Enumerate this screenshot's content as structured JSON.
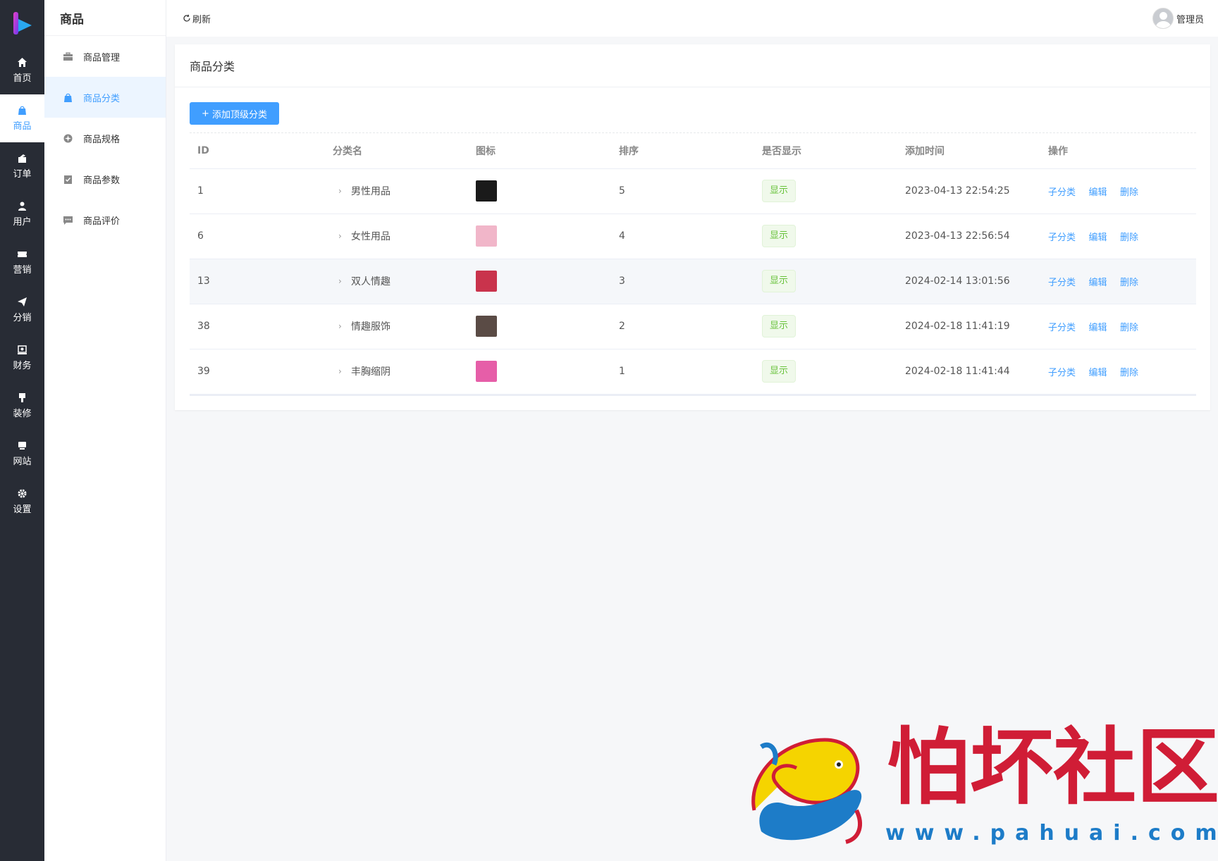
{
  "rail": {
    "items": [
      {
        "label": "首页",
        "icon": "home-icon"
      },
      {
        "label": "商品",
        "icon": "bag-icon",
        "active": true
      },
      {
        "label": "订单",
        "icon": "order-icon"
      },
      {
        "label": "用户",
        "icon": "user-icon"
      },
      {
        "label": "营销",
        "icon": "ticket-icon"
      },
      {
        "label": "分销",
        "icon": "send-icon"
      },
      {
        "label": "财务",
        "icon": "finance-icon"
      },
      {
        "label": "装修",
        "icon": "brush-icon"
      },
      {
        "label": "网站",
        "icon": "monitor-icon"
      },
      {
        "label": "设置",
        "icon": "gear-icon"
      }
    ]
  },
  "subnav": {
    "title": "商品",
    "items": [
      {
        "label": "商品管理",
        "icon": "briefcase-icon"
      },
      {
        "label": "商品分类",
        "icon": "bag-icon",
        "active": true
      },
      {
        "label": "商品规格",
        "icon": "spec-icon"
      },
      {
        "label": "商品参数",
        "icon": "clipboard-icon"
      },
      {
        "label": "商品评价",
        "icon": "comment-icon"
      }
    ]
  },
  "topbar": {
    "refresh_label": "刷新",
    "user_name": "管理员"
  },
  "card": {
    "title": "商品分类",
    "add_button": "添加顶级分类"
  },
  "table": {
    "headers": [
      "ID",
      "分类名",
      "图标",
      "排序",
      "是否显示",
      "添加时间",
      "操作"
    ],
    "rows": [
      {
        "id": "1",
        "name": "男性用品",
        "sort": "5",
        "show": "显示",
        "time": "2023-04-13 22:54:25",
        "thumb_color": "#1a1a1a"
      },
      {
        "id": "6",
        "name": "女性用品",
        "sort": "4",
        "show": "显示",
        "time": "2023-04-13 22:56:54",
        "thumb_color": "#f1b6c9"
      },
      {
        "id": "13",
        "name": "双人情趣",
        "sort": "3",
        "show": "显示",
        "time": "2024-02-14 13:01:56",
        "thumb_color": "#c9334c"
      },
      {
        "id": "38",
        "name": "情趣服饰",
        "sort": "2",
        "show": "显示",
        "time": "2024-02-18 11:41:19",
        "thumb_color": "#5a4b45"
      },
      {
        "id": "39",
        "name": "丰胸缩阴",
        "sort": "1",
        "show": "显示",
        "time": "2024-02-18 11:41:44",
        "thumb_color": "#e65ea8"
      }
    ],
    "ops": {
      "sub": "子分类",
      "edit": "编辑",
      "del": "删除"
    }
  },
  "watermark": {
    "text": "怕坏社区",
    "url": "www.pahuai.com"
  },
  "colors": {
    "primary": "#409eff",
    "rail_bg": "#282c35",
    "success": "#67c23a",
    "watermark_red": "#d01d36",
    "watermark_blue": "#1d7cc8"
  }
}
